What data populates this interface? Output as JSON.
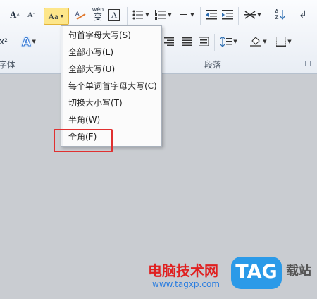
{
  "ribbon": {
    "font_group_label": "字体",
    "paragraph_group_label": "段落",
    "partial_label": "x²",
    "grow_font": "A",
    "shrink_font": "A",
    "change_case": "Aa",
    "text_effect": "A",
    "phonetic_top": "wén",
    "phonetic_bottom": "变",
    "char_border": "A",
    "sort_label": "A Z"
  },
  "menu": {
    "items": [
      {
        "label": "句首字母大写(S)"
      },
      {
        "label": "全部小写(L)"
      },
      {
        "label": "全部大写(U)"
      },
      {
        "label": "每个单词首字母大写(C)"
      },
      {
        "label": "切换大小写(T)"
      },
      {
        "label": "半角(W)"
      },
      {
        "label": "全角(F)"
      }
    ]
  },
  "watermark": {
    "cn": "电脑技术网",
    "url": "www.tagxp.com",
    "tag": "TAG",
    "site": "载站"
  },
  "colors": {
    "highlight_border": "#e03030",
    "change_case_bg": "#fde68a",
    "doc_bg": "#c9ccd1"
  }
}
